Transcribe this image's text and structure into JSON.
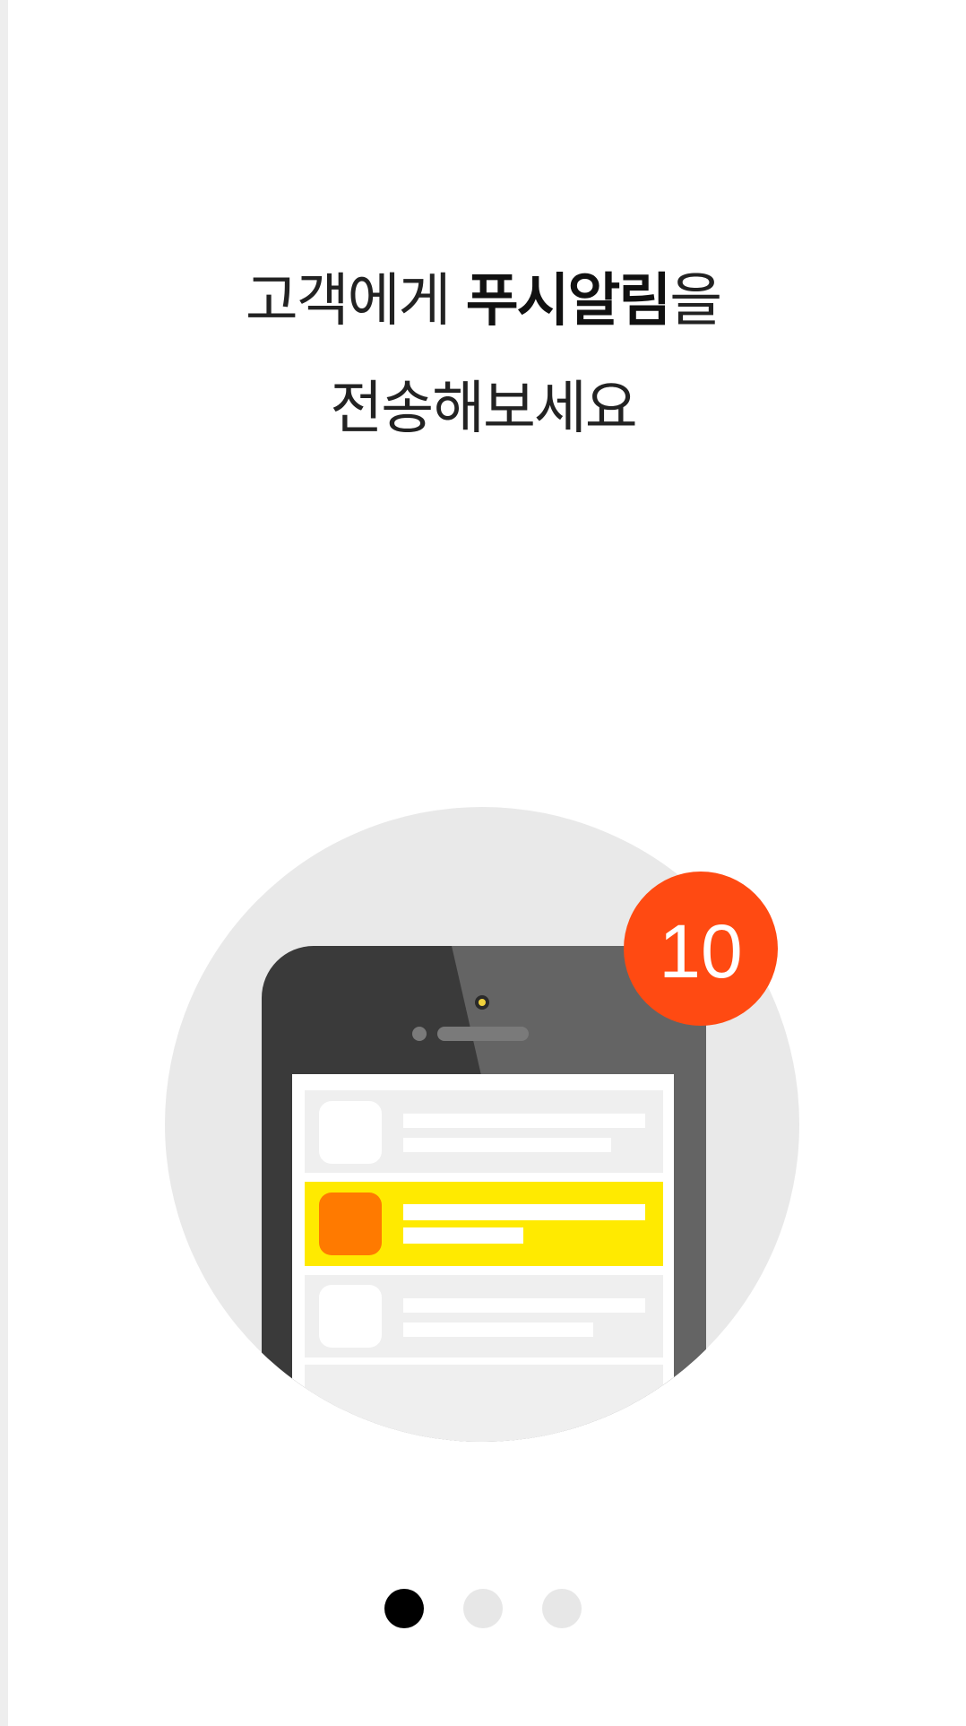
{
  "headline": {
    "line1_prefix": "고객에게 ",
    "line1_emphasis": "푸시알림",
    "line1_suffix": "을",
    "line2": "전송해보세요"
  },
  "illustration": {
    "badge_count": "10",
    "badge_color": "#ff4a12",
    "highlight_row_color": "#ffea00",
    "highlight_icon_color": "#ff7a00",
    "phone_color": "#3a3a3a",
    "circle_color": "#e9e9e9"
  },
  "pager": {
    "total_pages": 3,
    "active_index": 0
  }
}
